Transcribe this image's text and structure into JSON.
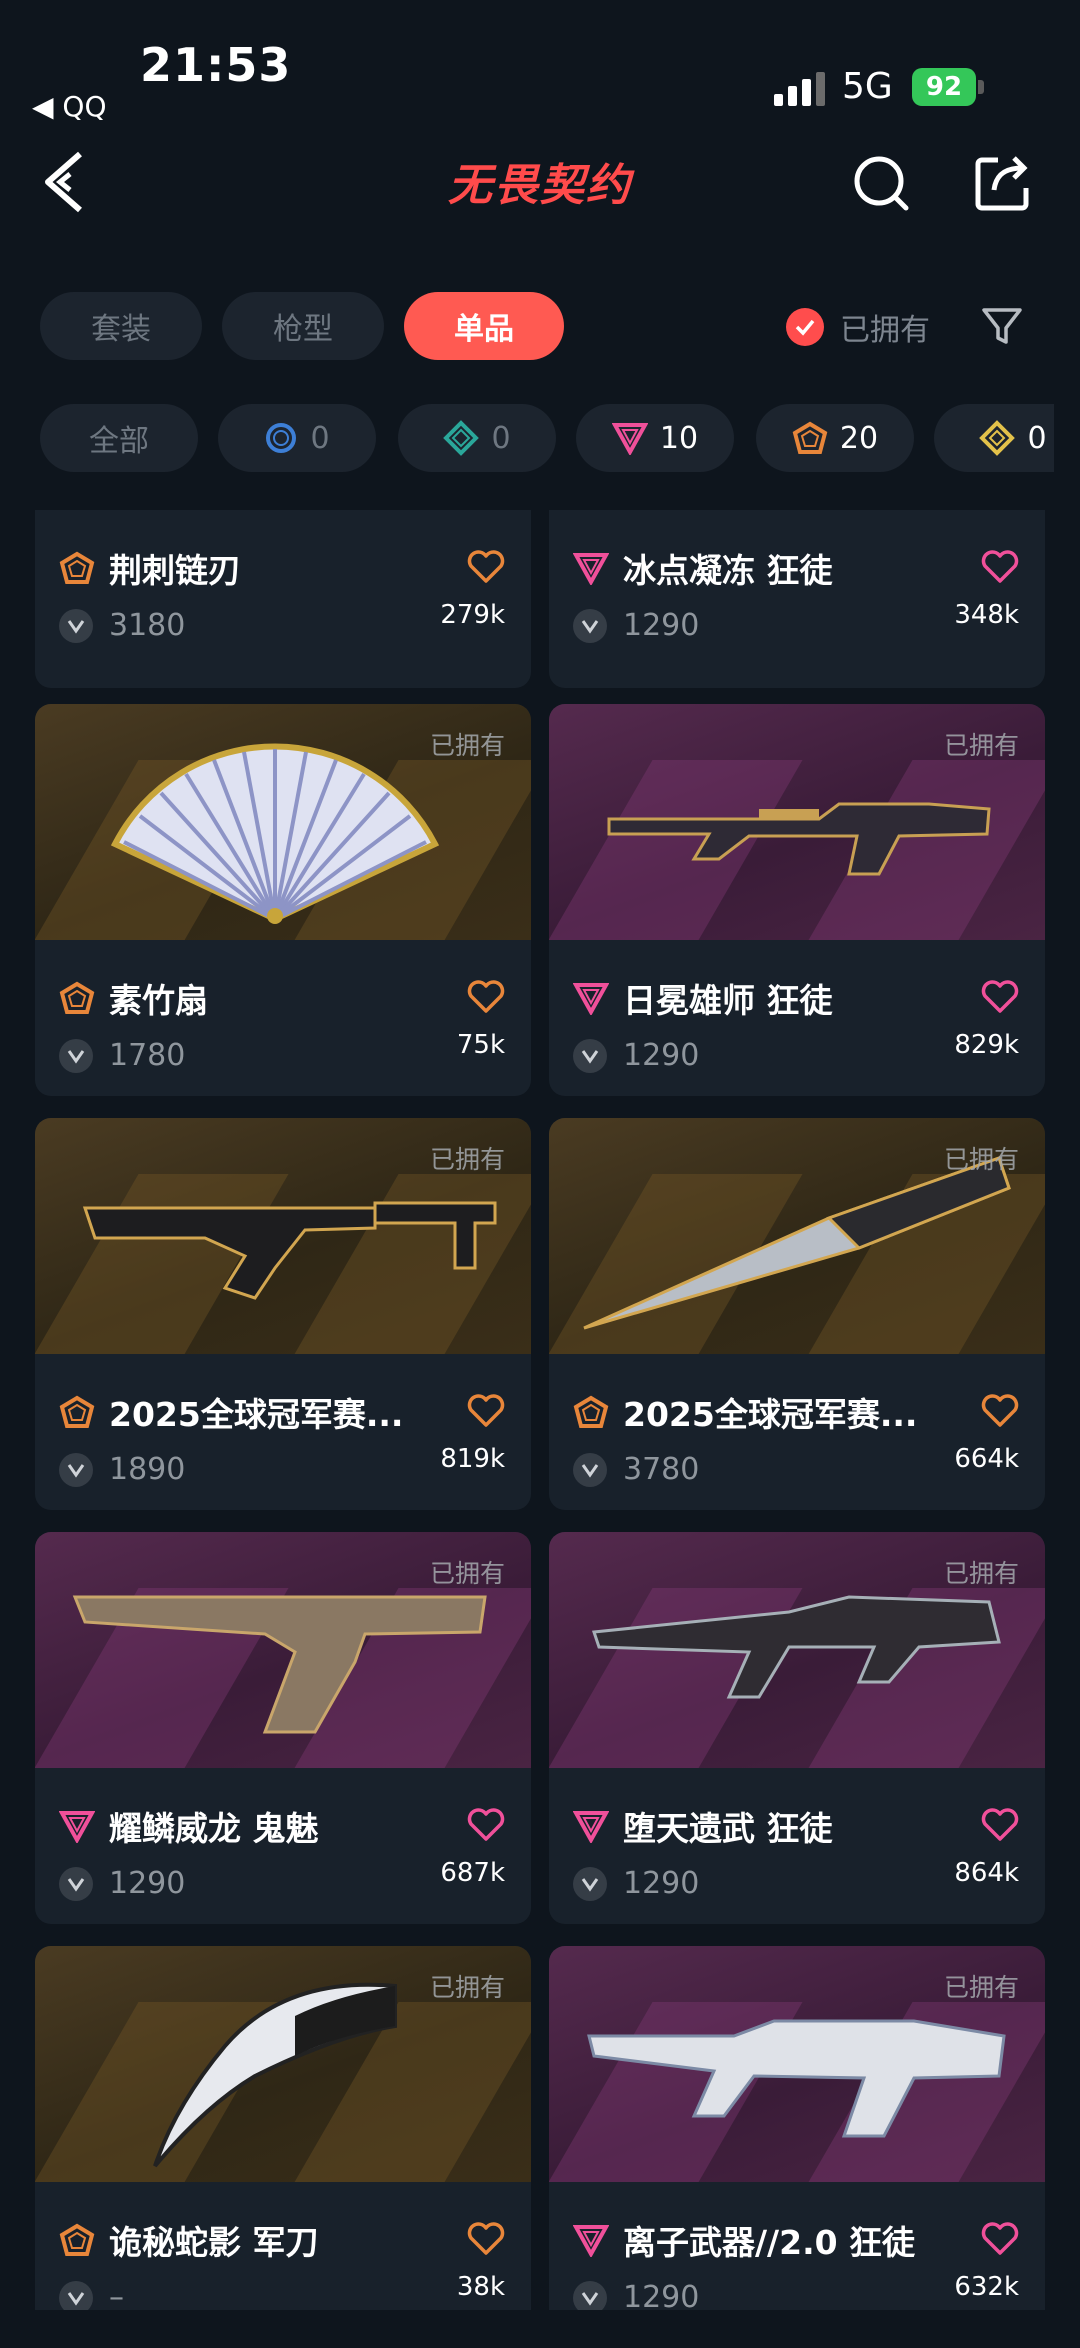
{
  "status_bar": {
    "time": "21:53",
    "back_app": "◀ QQ",
    "network": "5G",
    "battery": "92"
  },
  "header": {
    "title": "无畏契约"
  },
  "tabs": [
    {
      "label": "套装",
      "active": false
    },
    {
      "label": "枪型",
      "active": false
    },
    {
      "label": "单品",
      "active": true
    }
  ],
  "owned_filter": {
    "label": "已拥有",
    "checked": true
  },
  "rarity_chips": [
    {
      "label": "全部",
      "count": "",
      "tier": "all"
    },
    {
      "label": "",
      "count": "0",
      "tier": "blue"
    },
    {
      "label": "",
      "count": "0",
      "tier": "teal"
    },
    {
      "label": "",
      "count": "10",
      "tier": "pink"
    },
    {
      "label": "",
      "count": "20",
      "tier": "orange"
    },
    {
      "label": "",
      "count": "0",
      "tier": "gold"
    }
  ],
  "owned_label": "已拥有",
  "items": [
    {
      "name": "荆刺链刃",
      "tier": "orange",
      "price": "3180",
      "likes": "279k",
      "theme": "gold",
      "owned": false,
      "art": "none"
    },
    {
      "name": "冰点凝冻 狂徒",
      "tier": "pink",
      "price": "1290",
      "likes": "348k",
      "theme": "purple",
      "owned": false,
      "art": "none"
    },
    {
      "name": "素竹扇",
      "tier": "orange",
      "price": "1780",
      "likes": "75k",
      "theme": "gold",
      "owned": true,
      "art": "fan"
    },
    {
      "name": "日冕雄师 狂徒",
      "tier": "pink",
      "price": "1290",
      "likes": "829k",
      "theme": "purple",
      "owned": true,
      "art": "rifle-gold"
    },
    {
      "name": "2025全球冠军赛...",
      "tier": "orange",
      "price": "1890",
      "likes": "819k",
      "theme": "gold",
      "owned": true,
      "art": "smg"
    },
    {
      "name": "2025全球冠军赛...",
      "tier": "orange",
      "price": "3780",
      "likes": "664k",
      "theme": "gold",
      "owned": true,
      "art": "knife"
    },
    {
      "name": "耀鳞威龙 鬼魅",
      "tier": "pink",
      "price": "1290",
      "likes": "687k",
      "theme": "purple",
      "owned": true,
      "art": "pistol"
    },
    {
      "name": "堕天遗武 狂徒",
      "tier": "pink",
      "price": "1290",
      "likes": "864k",
      "theme": "purple",
      "owned": true,
      "art": "rifle-dark"
    },
    {
      "name": "诡秘蛇影 军刀",
      "tier": "orange",
      "price": "–",
      "likes": "38k",
      "theme": "gold",
      "owned": true,
      "art": "karambit"
    },
    {
      "name": "离子武器//2.0 狂徒",
      "tier": "pink",
      "price": "1290",
      "likes": "632k",
      "theme": "purple",
      "owned": true,
      "art": "rifle-white"
    }
  ],
  "colors": {
    "accent": "#ff5a52",
    "pink_tier": "#f0509a",
    "orange_tier": "#e8863a",
    "background": "#0e151d"
  }
}
